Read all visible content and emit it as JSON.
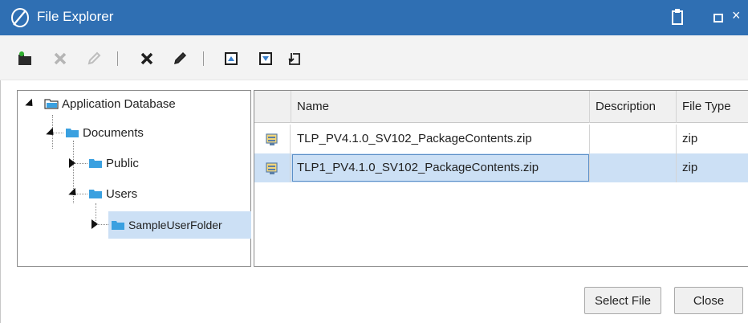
{
  "window": {
    "title": "File Explorer",
    "logo_icon": "orbit-logo-icon",
    "title_bar_color": "#2f6fb3"
  },
  "toolbar": {
    "buttons": [
      {
        "name": "new-folder-button",
        "icon": "new-folder-icon",
        "enabled": true
      },
      {
        "name": "delete-folder-button",
        "icon": "close-icon",
        "enabled": false
      },
      {
        "name": "rename-folder-button",
        "icon": "pencil-icon",
        "enabled": false
      },
      {
        "name": "delete-file-button",
        "icon": "close-icon",
        "enabled": true
      },
      {
        "name": "rename-file-button",
        "icon": "pencil-icon",
        "enabled": true
      },
      {
        "name": "upload-button",
        "icon": "upload-icon",
        "enabled": true
      },
      {
        "name": "download-button",
        "icon": "download-icon",
        "enabled": true
      },
      {
        "name": "import-button",
        "icon": "import-icon",
        "enabled": true
      }
    ]
  },
  "tree": {
    "root": "Application Database",
    "documents": "Documents",
    "public": "Public",
    "users": "Users",
    "sample_user_folder": "SampleUserFolder",
    "selected": "SampleUserFolder"
  },
  "grid": {
    "columns": {
      "name": "Name",
      "description": "Description",
      "file_type": "File Type"
    },
    "rows": [
      {
        "name": "TLP_PV4.1.0_SV102_PackageContents.zip",
        "description": "",
        "file_type": "zip",
        "selected": false
      },
      {
        "name": "TLP1_PV4.1.0_SV102_PackageContents.zip",
        "description": "",
        "file_type": "zip",
        "selected": true
      }
    ]
  },
  "footer": {
    "select_file_label": "Select File",
    "close_label": "Close"
  },
  "colors": {
    "accent": "#2f6fb3",
    "selection": "#cce0f5",
    "folder": "#3aa0e0"
  }
}
